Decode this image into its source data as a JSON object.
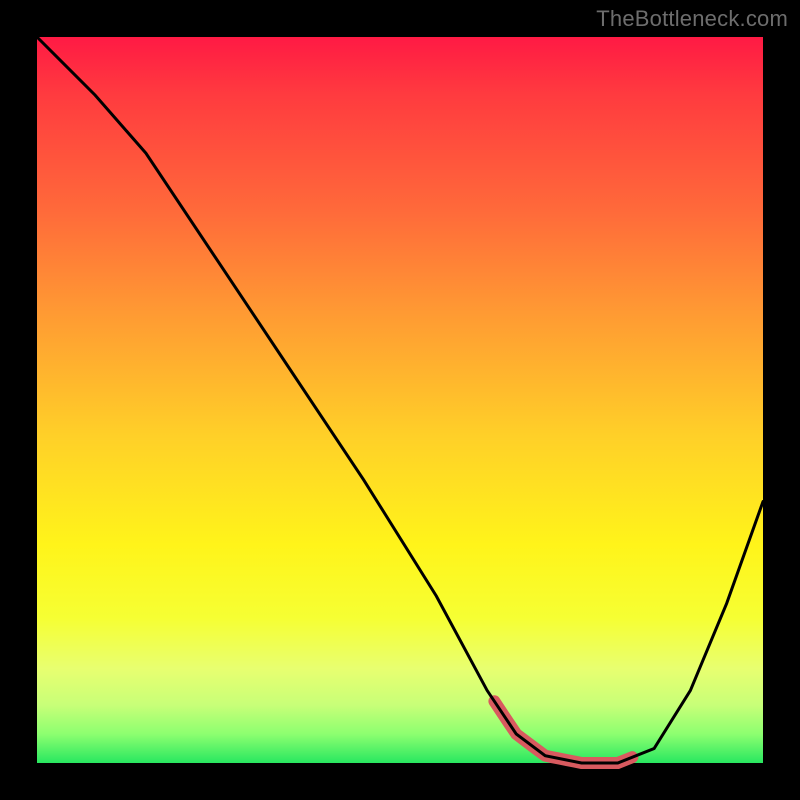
{
  "watermark": "TheBottleneck.com",
  "colors": {
    "frame": "#000000",
    "gradient_top": "#ff1a44",
    "gradient_bottom": "#28e760",
    "curve": "#000000",
    "highlight": "#d85a5f",
    "watermark_text": "#6d6d6d"
  },
  "chart_data": {
    "type": "line",
    "title": "",
    "xlabel": "",
    "ylabel": "",
    "xlim": [
      0,
      100
    ],
    "ylim": [
      0,
      100
    ],
    "grid": false,
    "series": [
      {
        "name": "bottleneck_curve",
        "x": [
          0,
          3,
          8,
          15,
          25,
          35,
          45,
          55,
          62,
          66,
          70,
          75,
          80,
          85,
          90,
          95,
          100
        ],
        "y": [
          100,
          97,
          92,
          84,
          69,
          54,
          39,
          23,
          10,
          4,
          1,
          0,
          0,
          2,
          10,
          22,
          36
        ]
      }
    ],
    "highlight_range_x": [
      63,
      82
    ],
    "note": "y is plotted with 0 at bottom, 100 at top; x with 0 at left, 100 at right"
  }
}
